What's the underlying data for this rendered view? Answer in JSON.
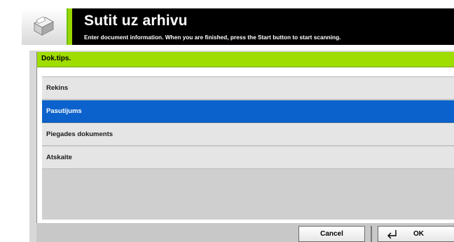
{
  "header": {
    "title": "Sutit uz arhivu",
    "subtitle": "Enter document information. When you are finished, press the Start button to start scanning.",
    "icon": "scanner-icon"
  },
  "field": {
    "label": "Dok.tips."
  },
  "list": {
    "items": [
      {
        "label": "Rekins",
        "selected": false
      },
      {
        "label": "Pasutijums",
        "selected": true
      },
      {
        "label": "Piegades dokuments",
        "selected": false
      },
      {
        "label": "Atskaite",
        "selected": false
      }
    ]
  },
  "footer": {
    "cancel_label": "Cancel",
    "ok_label": "OK",
    "ok_icon": "enter-icon"
  },
  "colors": {
    "accent_green": "#9bd600",
    "field_bar": "#9fdc00",
    "selected_row": "#0b62cc",
    "header_bg": "#000000"
  }
}
